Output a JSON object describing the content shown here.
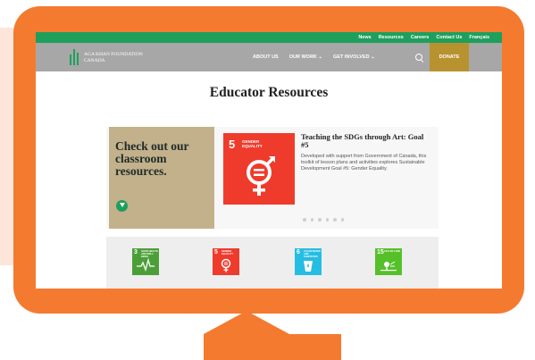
{
  "colors": {
    "monitor": "#f47a30",
    "peach": "#fde6d9",
    "topbar_green": "#1e9f5c",
    "nav_gray": "#a7a7a7",
    "donate_gold": "#b8922e",
    "promo_tan": "#c2b18a",
    "sdg5_red": "#ef3b2c",
    "sdg3_green": "#4c9f38",
    "sdg6_blue": "#26bde2",
    "sdg15_green": "#56c02b"
  },
  "topbar": {
    "links": [
      "News",
      "Resources",
      "Careers",
      "Contact Us",
      "Français"
    ]
  },
  "navbar": {
    "logo_line1": "AGA KHAN FOUNDATION",
    "logo_line2": "CANADA",
    "links": [
      "ABOUT US",
      "OUR WORK ⌄",
      "GET INVOLVED ⌄"
    ],
    "search_icon": "search-icon",
    "donate_label": "DONATE"
  },
  "page": {
    "title": "Educator Resources"
  },
  "slider": {
    "promo_text": "Check out our classroom resources.",
    "promo_icon": "arrow-down-circle-icon",
    "sdg5_number": "5",
    "sdg5_label": "GENDER EQUALITY",
    "slide_title": "Teaching the SDGs through Art: Goal #5",
    "slide_description": "Developed with support from Government of Canada, this toolkit of lesson plans and activities explores Sustainable Development Goal #5: Gender Equality.",
    "dot_count": 6
  },
  "goals": [
    {
      "number": "3",
      "label": "GOOD HEALTH AND WELL-BEING",
      "color": "#4c9f38",
      "icon": "heartbeat-icon"
    },
    {
      "number": "5",
      "label": "GENDER EQUALITY",
      "color": "#ef3b2c",
      "icon": "gender-equality-icon"
    },
    {
      "number": "6",
      "label": "CLEAN WATER AND SANITATION",
      "color": "#26bde2",
      "icon": "water-icon"
    },
    {
      "number": "15",
      "label": "LIFE ON LAND",
      "color": "#56c02b",
      "icon": "tree-icon"
    }
  ]
}
